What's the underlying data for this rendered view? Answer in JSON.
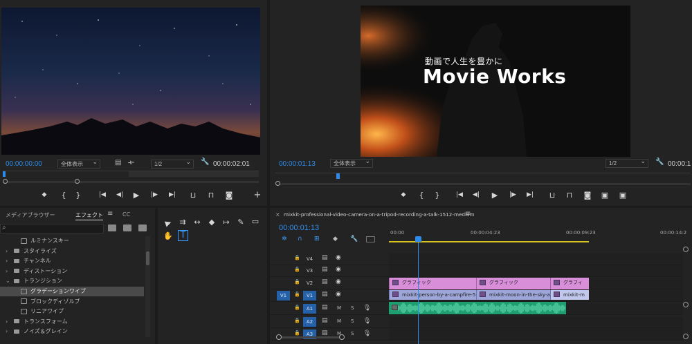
{
  "source_monitor": {
    "timecode": "00:00:00:00",
    "fit": "全体表示",
    "resolution": "1/2",
    "duration": "00:00:02:01"
  },
  "program_monitor": {
    "title_line1": "動画で人生を豊かに",
    "title_line2": "Movie Works",
    "timecode": "00:00:01:13",
    "fit": "全体表示",
    "resolution": "1/2",
    "duration": "00:00:1"
  },
  "transport": {
    "mark_in": "◆",
    "brace_open": "{",
    "brace_close": "}",
    "go_in": "|◀",
    "step_back": "◀|",
    "play": "▶",
    "step_fwd": "|▶",
    "go_out": "▶|",
    "insert": "⊔",
    "overwrite": "⊓",
    "camera": "◙",
    "add": "+",
    "lift": "⊔",
    "extract": "⊓",
    "export": "◙",
    "cmp1": "▣",
    "cmp2": "▣"
  },
  "effects_panel": {
    "tab_media": "メディアブラウザー",
    "tab_effects": "エフェクト",
    "tab_cc": "CC",
    "menu": "≡",
    "search_icon": "⌕",
    "items": [
      {
        "label": "ルミナンスキー",
        "type": "effect",
        "indent": 2
      },
      {
        "label": "スタイライズ",
        "type": "folder",
        "indent": 1
      },
      {
        "label": "チャンネル",
        "type": "folder",
        "indent": 1
      },
      {
        "label": "ディストーション",
        "type": "folder",
        "indent": 1
      },
      {
        "label": "トランジション",
        "type": "folder-open",
        "indent": 1
      },
      {
        "label": "グラデーションワイプ",
        "type": "effect",
        "indent": 2,
        "selected": true
      },
      {
        "label": "ブロックディゾルブ",
        "type": "effect",
        "indent": 2
      },
      {
        "label": "リニアワイプ",
        "type": "effect",
        "indent": 2
      },
      {
        "label": "トランスフォーム",
        "type": "folder",
        "indent": 1
      },
      {
        "label": "ノイズ＆グレイン",
        "type": "folder",
        "indent": 1
      }
    ]
  },
  "tools": {
    "select": "▶",
    "track": "⇉",
    "ripple": "↔",
    "razor": "◆",
    "slip": "↦",
    "pen": "✎",
    "rect": "▭",
    "hand": "✋",
    "type": "T"
  },
  "timeline": {
    "sequence_name": "mixkit-professional-video-camera-on-a-tripod-recording-a-talk-1512-medium",
    "menu": "≡",
    "close": "×",
    "timecode": "00:00:01:13",
    "ruler": [
      "00:00",
      "00:00:04:23",
      "00:00:09:23",
      "00:00:14:2"
    ],
    "tracks": [
      {
        "target": "",
        "name": "V4",
        "eye": "◉",
        "rec": "▤",
        "lock": "🔒"
      },
      {
        "target": "",
        "name": "V3",
        "eye": "◉",
        "rec": "▤",
        "lock": "🔒"
      },
      {
        "target": "",
        "name": "V2",
        "eye": "◉",
        "rec": "▤",
        "lock": "🔒"
      },
      {
        "target": "V1",
        "name": "V1",
        "eye": "◉",
        "rec": "▤",
        "lock": "🔒"
      },
      {
        "target": "",
        "name": "A1",
        "m": "M",
        "s": "S",
        "mic": "🎙",
        "rec": "▤",
        "lock": "🔒"
      },
      {
        "target": "",
        "name": "A2",
        "m": "M",
        "s": "S",
        "mic": "🎙",
        "rec": "▤",
        "lock": "🔒"
      },
      {
        "target": "",
        "name": "A3",
        "m": "M",
        "s": "S",
        "mic": "🎙",
        "rec": "▤",
        "lock": "🔒"
      }
    ],
    "gfx_clips": [
      "グラフィック",
      "グラフィック",
      "グラフィ"
    ],
    "video_clips": [
      "mixkit-person-by-a-campfire-5",
      "mixkit-moon-in-the-sky-a",
      "mixkit-m"
    ]
  },
  "colors": {
    "accent": "#2d8ceb",
    "graphic_clip": "#d88ed8",
    "video_clip": "#9ea6d9",
    "audio_clip": "#1f9e72"
  }
}
